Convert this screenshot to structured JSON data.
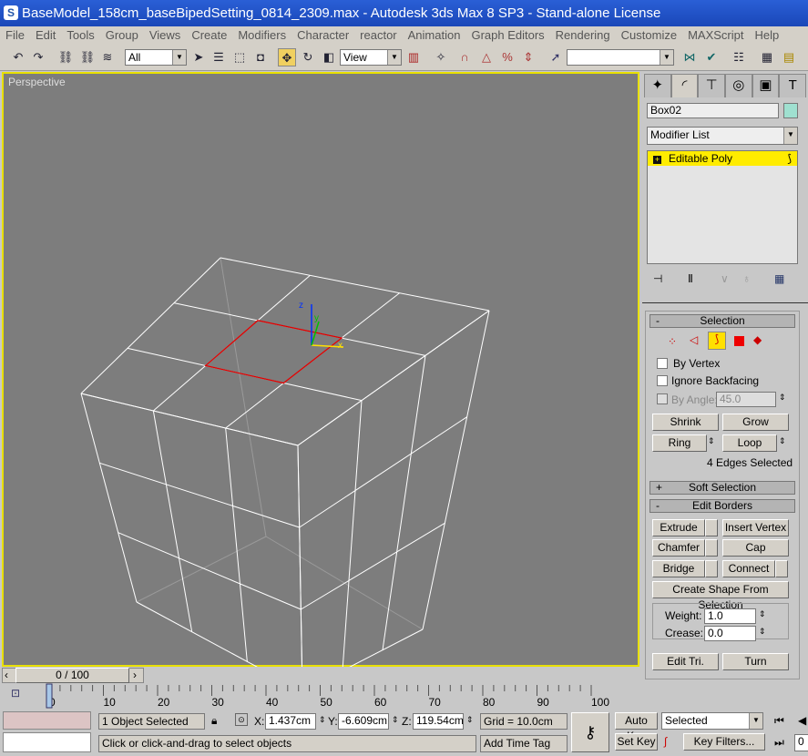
{
  "window": {
    "title": "BaseModel_158cm_baseBipedSetting_0814_2309.max - Autodesk 3ds Max 8 SP3  - Stand-alone License"
  },
  "menu": [
    "File",
    "Edit",
    "Tools",
    "Group",
    "Views",
    "Create",
    "Modifiers",
    "Character",
    "reactor",
    "Animation",
    "Graph Editors",
    "Rendering",
    "Customize",
    "MAXScript",
    "Help"
  ],
  "toolbar": {
    "selection_filter": "All",
    "reference_coord": "View",
    "named_selection": ""
  },
  "viewport": {
    "label": "Perspective",
    "axis_labels": {
      "x": "x",
      "y": "y",
      "z": "z"
    }
  },
  "panel": {
    "tabs": [
      "create-icon",
      "modify-icon",
      "hierarchy-icon",
      "motion-icon",
      "display-icon",
      "utilities-icon"
    ],
    "object_name": "Box02",
    "object_color": "#9fe0d0",
    "modifier_list": "Modifier List",
    "stack_item": "Editable Poly",
    "selection": {
      "title": "Selection",
      "by_vertex": "By Vertex",
      "ignore_backfacing": "Ignore Backfacing",
      "by_angle": "By Angle:",
      "angle_value": "45.0",
      "shrink": "Shrink",
      "grow": "Grow",
      "ring": "Ring",
      "loop": "Loop",
      "status": "4 Edges Selected"
    },
    "soft_selection": {
      "title": "Soft Selection"
    },
    "edit_borders": {
      "title": "Edit Borders",
      "extrude": "Extrude",
      "insert_vertex": "Insert Vertex",
      "chamfer": "Chamfer",
      "cap": "Cap",
      "bridge": "Bridge",
      "connect": "Connect",
      "create_shape": "Create Shape From Selection",
      "weight_label": "Weight:",
      "weight": "1.0",
      "crease_label": "Crease:",
      "crease": "0.0",
      "edit_tri": "Edit Tri.",
      "turn": "Turn"
    }
  },
  "timeline": {
    "slider": "0 / 100",
    "ticks": [
      "0",
      "10",
      "20",
      "30",
      "40",
      "50",
      "60",
      "70",
      "80",
      "90",
      "100"
    ],
    "current_frame": 0
  },
  "status": {
    "selected": "1 Object Selected",
    "x_label": "X:",
    "x": "1.437cm",
    "y_label": "Y:",
    "y": "-6.609cm",
    "z_label": "Z:",
    "z": "119.54cm",
    "grid": "Grid = 10.0cm",
    "prompt": "Click or click-and-drag to select objects",
    "add_time_tag": "Add Time Tag",
    "auto_key": "Auto Key",
    "set_key": "Set Key",
    "key_mode": "Selected",
    "key_filters": "Key Filters...",
    "frame": "0"
  }
}
